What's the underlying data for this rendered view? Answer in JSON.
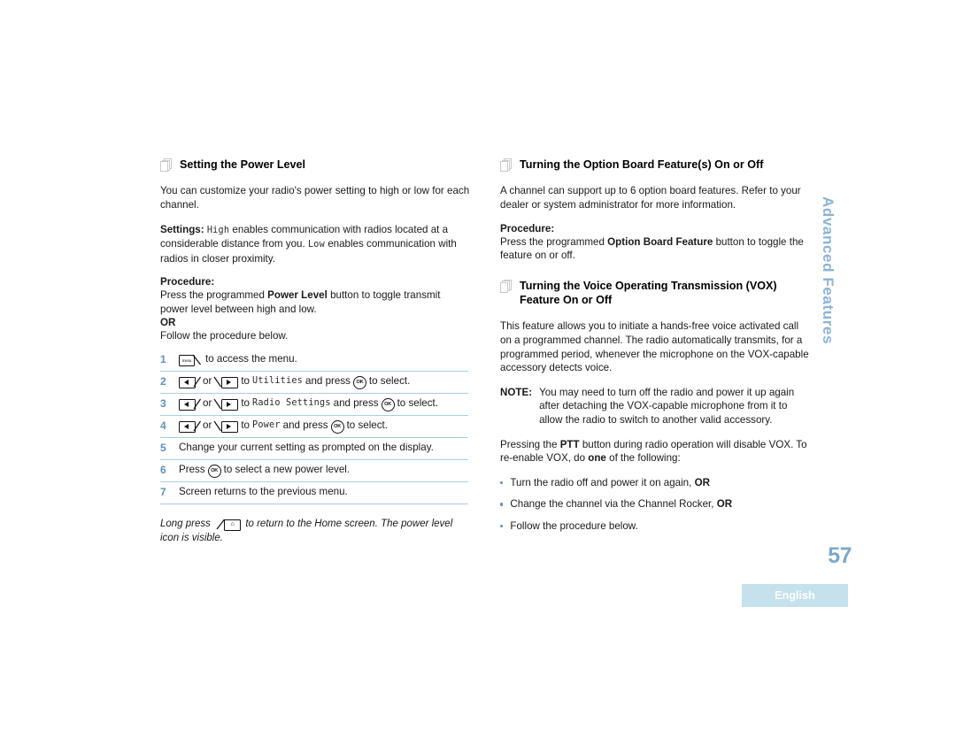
{
  "page": {
    "number": "57",
    "language_tab": "English",
    "side_tab": "Advanced Features"
  },
  "left_column": {
    "heading": "Setting the Power Level",
    "intro": "You can customize your radio's power setting to high or low for each channel.",
    "settings_label": "Settings:",
    "settings_high": "High",
    "settings_text_1": "enables communication with radios located at a considerable distance from you.",
    "settings_low": "Low",
    "settings_text_2": "enables communication with radios in closer proximity.",
    "procedure_label": "Procedure:",
    "procedure_line_1_pre": "Press the programmed",
    "procedure_line_1_bold": "Power Level",
    "procedure_line_1_post": "button to toggle transmit power level between high and low.",
    "or_label": "OR",
    "procedure_line_2": "Follow the procedure below.",
    "steps": [
      {
        "num": "1",
        "icon": "menu-key",
        "text_after": "to access the menu."
      },
      {
        "num": "2",
        "icon": "left-right-keys",
        "text_to": "to",
        "target": "Utilities",
        "text_press": "and press",
        "icon2": "ok-key",
        "text_end": "to select."
      },
      {
        "num": "3",
        "icon": "left-right-keys",
        "text_to": "to",
        "target": "Radio Settings",
        "text_press": "and press",
        "icon2": "ok-key",
        "text_end": "to select."
      },
      {
        "num": "4",
        "icon": "left-right-keys",
        "text_to": "to",
        "target": "Power",
        "text_press": "and press",
        "icon2": "ok-key",
        "text_end": "to select."
      },
      {
        "num": "5",
        "icon": "none",
        "text_plain": "Change your current setting as prompted on the display."
      },
      {
        "num": "6",
        "icon": "ok-key-inline",
        "text_pre": "Press",
        "text_end": "to select a new power level."
      },
      {
        "num": "7",
        "icon": "none",
        "text_plain": "Screen returns to the previous menu."
      }
    ],
    "closing_note_pre": "Long press",
    "closing_note_icon": "home-key",
    "closing_note_post": "to return to the Home screen. The power level icon is visible.",
    "step_or_label": "or",
    "menu_key_label": "menu",
    "home_key_glyph": "⌂",
    "ok_key_label": "OK"
  },
  "right_column": {
    "heading_1": "Turning the Option Board Feature(s) On or Off",
    "intro_1": "A channel can support up to 6 option board features. Refer to your dealer or system administrator for more information.",
    "procedure_label": "Procedure:",
    "procedure_pre": "Press the programmed",
    "procedure_bold": "Option Board Feature",
    "procedure_post": "button to toggle the feature on or off.",
    "heading_2": "Turning the Voice Operating Transmission (VOX) Feature On or Off",
    "intro_2": "This feature allows you to initiate a hands-free voice activated call on a programmed channel. The radio automatically transmits, for a programmed period, whenever the microphone on the VOX-capable accessory detects voice.",
    "note_label": "NOTE:",
    "note_text": "You may need to turn off the radio and power it up again after detaching the VOX-capable microphone from it to allow the radio to switch to another valid accessory.",
    "ptt_pre": "Pressing the",
    "ptt_bold": "PTT",
    "ptt_mid": "button during radio operation will disable VOX. To re-enable VOX, do",
    "ptt_bold_2": "one",
    "ptt_post": "of the following:",
    "bullets": [
      {
        "text": "Turn the radio off and power it on again,",
        "bold_tail": "OR"
      },
      {
        "text": "Change the channel via the Channel Rocker,",
        "bold_tail": "OR"
      },
      {
        "text": "Follow the procedure below.",
        "bold_tail": ""
      }
    ]
  },
  "colors": {
    "accent_blue": "#5c92bd",
    "rule_blue": "#aacfe4",
    "tab_blue": "#c5e1ec",
    "side_tab_blue": "#8cb4d2",
    "page_number_blue": "#7da9c9"
  }
}
